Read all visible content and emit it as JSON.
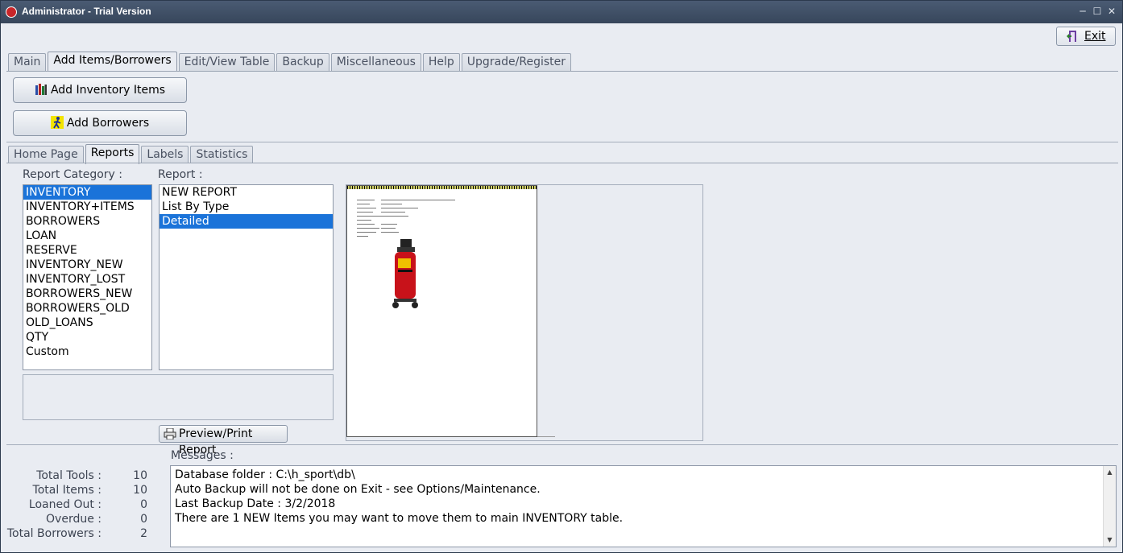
{
  "window": {
    "title": "Administrator - Trial Version",
    "minimize": "─",
    "maximize": "☐",
    "close": "✕"
  },
  "toolbar": {
    "exit_label": "Exit"
  },
  "main_tabs": [
    "Main",
    "Add Items/Borrowers",
    "Edit/View Table",
    "Backup",
    "Miscellaneous",
    "Help",
    "Upgrade/Register"
  ],
  "main_tabs_active": 1,
  "actions": {
    "add_inventory": "Add Inventory Items",
    "add_borrowers": "Add Borrowers"
  },
  "sub_tabs": [
    "Home Page",
    "Reports",
    "Labels",
    "Statistics"
  ],
  "sub_tabs_active": 1,
  "reports": {
    "category_label": "Report Category :",
    "report_label": "Report :",
    "categories": [
      "INVENTORY",
      "INVENTORY+ITEMS",
      "BORROWERS",
      "LOAN",
      "RESERVE",
      "INVENTORY_NEW",
      "INVENTORY_LOST",
      "BORROWERS_NEW",
      "BORROWERS_OLD",
      "OLD_LOANS",
      "QTY",
      "Custom"
    ],
    "categories_selected": 0,
    "reports": [
      "NEW REPORT",
      "List By Type",
      "Detailed"
    ],
    "reports_selected": 2,
    "preview_button": "Preview/Print Report"
  },
  "messages": {
    "label": "Messages :",
    "lines": [
      "Database folder : C:\\h_sport\\db\\",
      "Auto Backup will not be done on Exit - see Options/Maintenance.",
      "Last Backup Date : 3/2/2018",
      "There are 1 NEW Items you may want to move them to main INVENTORY table."
    ]
  },
  "stats": [
    {
      "label": "Total Tools :",
      "value": "10"
    },
    {
      "label": "Total Items :",
      "value": "10"
    },
    {
      "label": "Loaned Out :",
      "value": "0"
    },
    {
      "label": "Overdue :",
      "value": "0"
    },
    {
      "label": "Total Borrowers :",
      "value": "2"
    }
  ],
  "colors": {
    "selection": "#1a73d9",
    "titlebar": "#3f4f66",
    "background": "#e9ecf2"
  }
}
